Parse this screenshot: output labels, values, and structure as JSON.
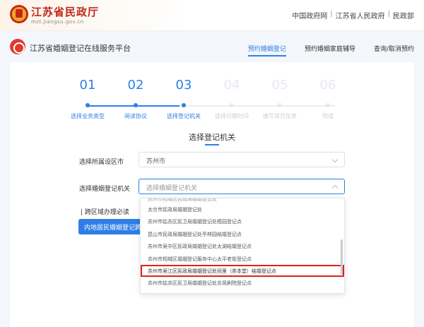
{
  "gov": {
    "title": "江苏省民政厅",
    "domain": "mzt.jiangsu.gov.cn",
    "links": [
      "中国政府网",
      "江苏省人民政府",
      "民政部"
    ]
  },
  "platform": {
    "title": "江苏省婚姻登记在线服务平台",
    "tabs": [
      "预约婚姻登记",
      "预约婚姻家庭辅导",
      "查询/取消预约"
    ],
    "active_tab": "预约婚姻登记"
  },
  "stepper": {
    "steps": [
      {
        "num": "01",
        "label": "选择业务类型",
        "active": true
      },
      {
        "num": "02",
        "label": "阅读协议",
        "active": true
      },
      {
        "num": "03",
        "label": "选择登记机关",
        "active": true
      },
      {
        "num": "04",
        "label": "选择日期时间",
        "active": false
      },
      {
        "num": "05",
        "label": "填写双方信息",
        "active": false
      },
      {
        "num": "06",
        "label": "完成",
        "active": false
      }
    ]
  },
  "section": {
    "title": "选择登记机关"
  },
  "form": {
    "city_label": "选择所属设区市",
    "city_value": "苏州市",
    "office_label": "选择婚姻登记机关",
    "office_placeholder": "选择婚姻登记机关",
    "cross_region_label": "跨区域办理必读",
    "cross_region_button": "内地居民婚姻登记跨区域办理"
  },
  "dropdown": {
    "items": [
      "苏州市相城区民政局婚姻登记处",
      "太仓市民政局婚姻登记处",
      "苏州市姑苏区民卫局婚姻登记处梧园登记点",
      "昆山市民政局婚姻登记处亭林园结婚登记点",
      "苏州市吴中区民政局婚姻登记处太湖结婚登记点",
      "苏州市相城区婚姻登记服务中心太平老街登记点",
      "苏州市吴江区民政局婚姻登记处同里（崇本堂）结婚登记点",
      "苏州市姑苏区民卫局婚姻登记处苏晃刷院登记点"
    ],
    "highlighted_index": 6
  },
  "colors": {
    "accent": "#2f7ee6",
    "highlight": "#e02020",
    "brand_red": "#c0281c"
  }
}
